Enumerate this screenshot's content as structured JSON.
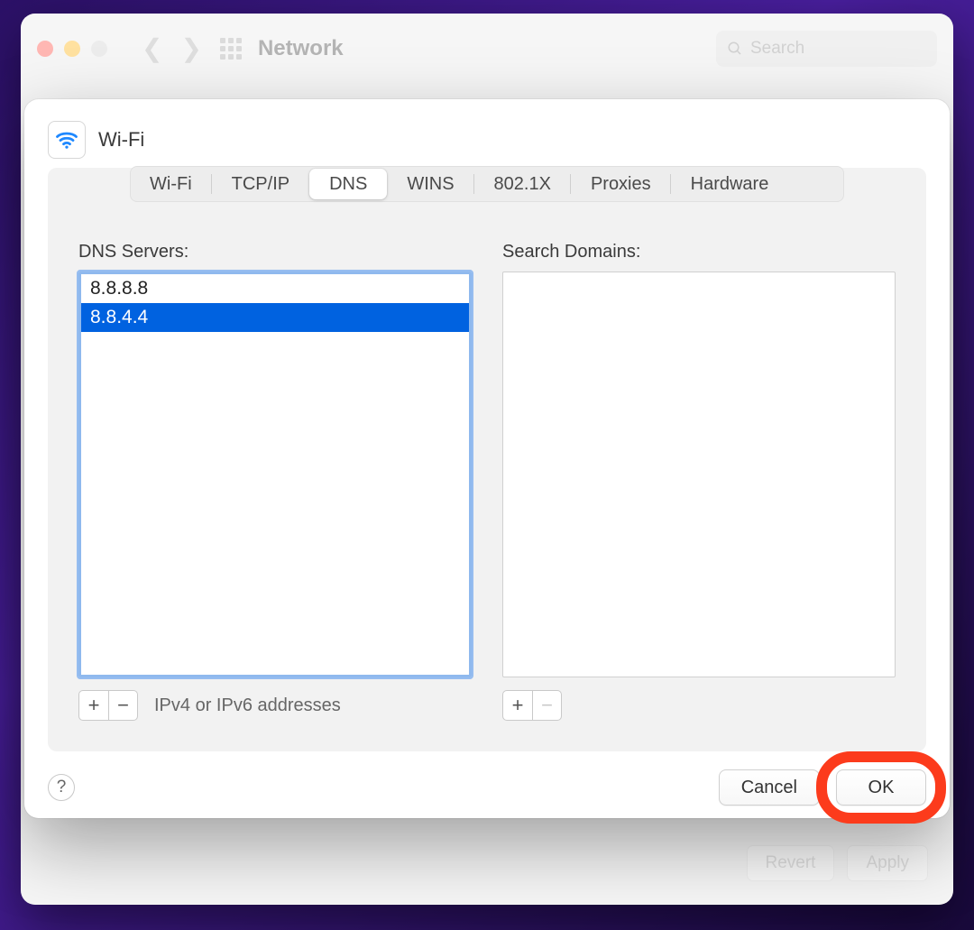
{
  "window": {
    "title": "Network",
    "search_placeholder": "Search"
  },
  "bottom": {
    "revert": "Revert",
    "apply": "Apply"
  },
  "sheet": {
    "title": "Wi-Fi",
    "tabs": [
      {
        "label": "Wi-Fi",
        "active": false
      },
      {
        "label": "TCP/IP",
        "active": false
      },
      {
        "label": "DNS",
        "active": true
      },
      {
        "label": "WINS",
        "active": false
      },
      {
        "label": "802.1X",
        "active": false
      },
      {
        "label": "Proxies",
        "active": false
      },
      {
        "label": "Hardware",
        "active": false
      }
    ],
    "dns": {
      "servers_label": "DNS Servers:",
      "servers": [
        {
          "value": "8.8.8.8",
          "selected": false
        },
        {
          "value": "8.8.4.4",
          "selected": true
        }
      ],
      "servers_hint": "IPv4 or IPv6 addresses",
      "domains_label": "Search Domains:",
      "domains": []
    },
    "footer": {
      "help": "?",
      "cancel": "Cancel",
      "ok": "OK"
    }
  },
  "icons": {
    "search": "search-icon",
    "wifi": "wifi-icon"
  }
}
